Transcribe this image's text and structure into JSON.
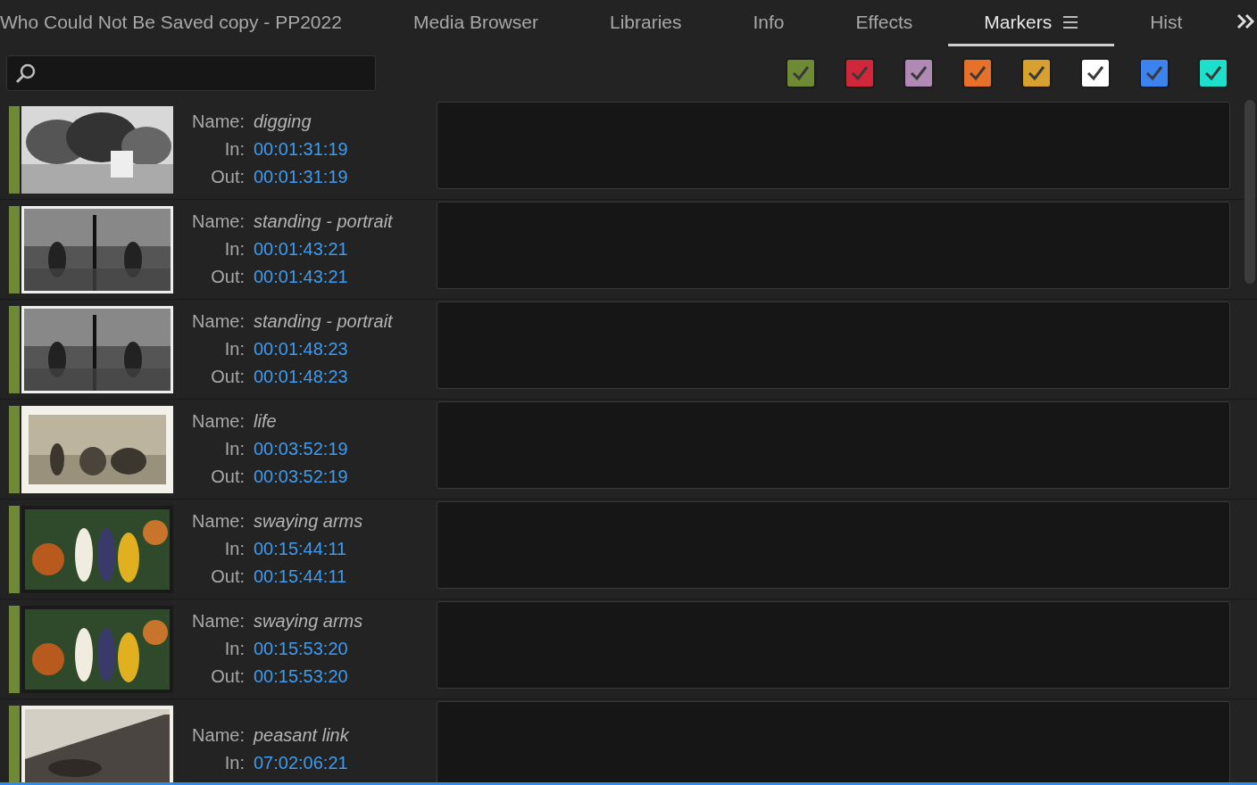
{
  "tabs": [
    {
      "label": "Who Could Not Be Saved  copy - PP2022",
      "selected": false
    },
    {
      "label": "Media Browser",
      "selected": false
    },
    {
      "label": "Libraries",
      "selected": false
    },
    {
      "label": "Info",
      "selected": false
    },
    {
      "label": "Effects",
      "selected": false
    },
    {
      "label": "Markers",
      "selected": true
    },
    {
      "label": "Hist",
      "selected": false
    }
  ],
  "color_filters": [
    {
      "color": "#6e8a34",
      "checked": true
    },
    {
      "color": "#d0283a",
      "checked": true
    },
    {
      "color": "#b08ab4",
      "checked": true
    },
    {
      "color": "#e8712a",
      "checked": true
    },
    {
      "color": "#d6a12e",
      "checked": true
    },
    {
      "color": "#ffffff",
      "checked": true
    },
    {
      "color": "#3d83f0",
      "checked": true
    },
    {
      "color": "#1de0cc",
      "checked": true
    }
  ],
  "markers": [
    {
      "color": "#6e8a34",
      "name_label": "Name:",
      "name": "digging",
      "in_label": "In:",
      "in": "00:01:31:19",
      "out_label": "Out:",
      "out": "00:01:31:19"
    },
    {
      "color": "#6e8a34",
      "name_label": "Name:",
      "name": "standing - portrait",
      "in_label": "In:",
      "in": "00:01:43:21",
      "out_label": "Out:",
      "out": "00:01:43:21"
    },
    {
      "color": "#6e8a34",
      "name_label": "Name:",
      "name": "standing - portrait",
      "in_label": "In:",
      "in": "00:01:48:23",
      "out_label": "Out:",
      "out": "00:01:48:23"
    },
    {
      "color": "#6e8a34",
      "name_label": "Name:",
      "name": "life",
      "in_label": "In:",
      "in": "00:03:52:19",
      "out_label": "Out:",
      "out": "00:03:52:19"
    },
    {
      "color": "#6e8a34",
      "name_label": "Name:",
      "name": "swaying arms",
      "in_label": "In:",
      "in": "00:15:44:11",
      "out_label": "Out:",
      "out": "00:15:44:11"
    },
    {
      "color": "#6e8a34",
      "name_label": "Name:",
      "name": "swaying arms",
      "in_label": "In:",
      "in": "00:15:53:20",
      "out_label": "Out:",
      "out": "00:15:53:20"
    },
    {
      "color": "#6e8a34",
      "name_label": "Name:",
      "name": "peasant link",
      "in_label": "In:",
      "in": "07:02:06:21"
    }
  ]
}
